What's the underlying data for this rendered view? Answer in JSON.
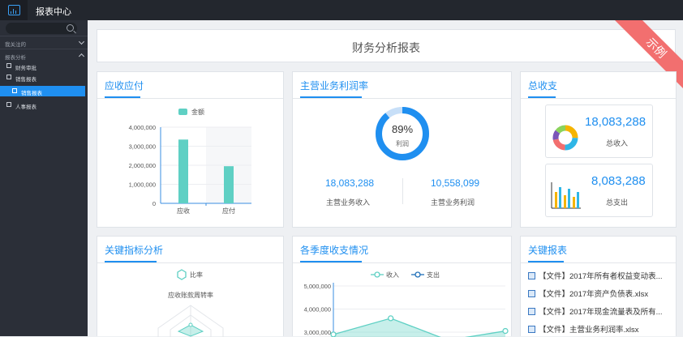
{
  "app": {
    "title": "报表中心",
    "logo_icon": "chart-icon"
  },
  "sidebar": {
    "search_placeholder": "",
    "groups": [
      {
        "label": "我关注的",
        "expanded": false
      },
      {
        "label": "报表分析",
        "expanded": true
      }
    ],
    "items": [
      {
        "label": "财务审批",
        "icon": "folder-icon",
        "active": false
      },
      {
        "label": "销售报表",
        "icon": "calendar-icon",
        "active": false
      },
      {
        "label": "销售报表",
        "icon": "file-icon",
        "active": true
      },
      {
        "label": "人事报表",
        "icon": "folder-icon",
        "active": false
      }
    ]
  },
  "page": {
    "title": "财务分析报表",
    "ribbon": "示例"
  },
  "receivable": {
    "title": "应收应付",
    "chart_data": {
      "type": "bar",
      "categories": [
        "应收",
        "应付"
      ],
      "series": [
        {
          "name": "金额",
          "values": [
            3350000,
            1950000
          ]
        }
      ],
      "ylim": [
        0,
        4000000
      ],
      "yticks": [
        "0",
        "1,000,000",
        "2,000,000",
        "3,000,000",
        "4,000,000"
      ],
      "legend": "top",
      "color": "#5fd0c4"
    }
  },
  "profit": {
    "title": "主营业务利润率",
    "donut_percent": 89,
    "percent_label": "89%",
    "center_label": "利润",
    "income_value": "18,083,288",
    "income_label": "主营业务收入",
    "profit_value": "10,558,099",
    "profit_label": "主营业务利润",
    "color": "#1f8ff0"
  },
  "totals": {
    "title": "总收支",
    "income_value": "18,083,288",
    "income_label": "总收入",
    "expense_value": "8,083,288",
    "expense_label": "总支出"
  },
  "kpi": {
    "title": "关键指标分析",
    "legend": "比率",
    "indicator": "应收账款周转率"
  },
  "quarter": {
    "title": "各季度收支情况",
    "chart_data": {
      "type": "line",
      "series": [
        {
          "name": "收入",
          "values": [
            2900000,
            3600000,
            2650000,
            3050000
          ]
        },
        {
          "name": "支出",
          "values": []
        }
      ],
      "yticks": [
        "3,000,000",
        "4,000,000",
        "5,000,000"
      ],
      "ylim": [
        3000000,
        5000000
      ],
      "legend": "top"
    }
  },
  "reports": {
    "title": "关键报表",
    "files": [
      "【文件】2017年所有者权益变动表...",
      "【文件】2017年资产负债表.xlsx",
      "【文件】2017年现金流量表及所有...",
      "【文件】主营业务利润率.xlsx"
    ]
  }
}
